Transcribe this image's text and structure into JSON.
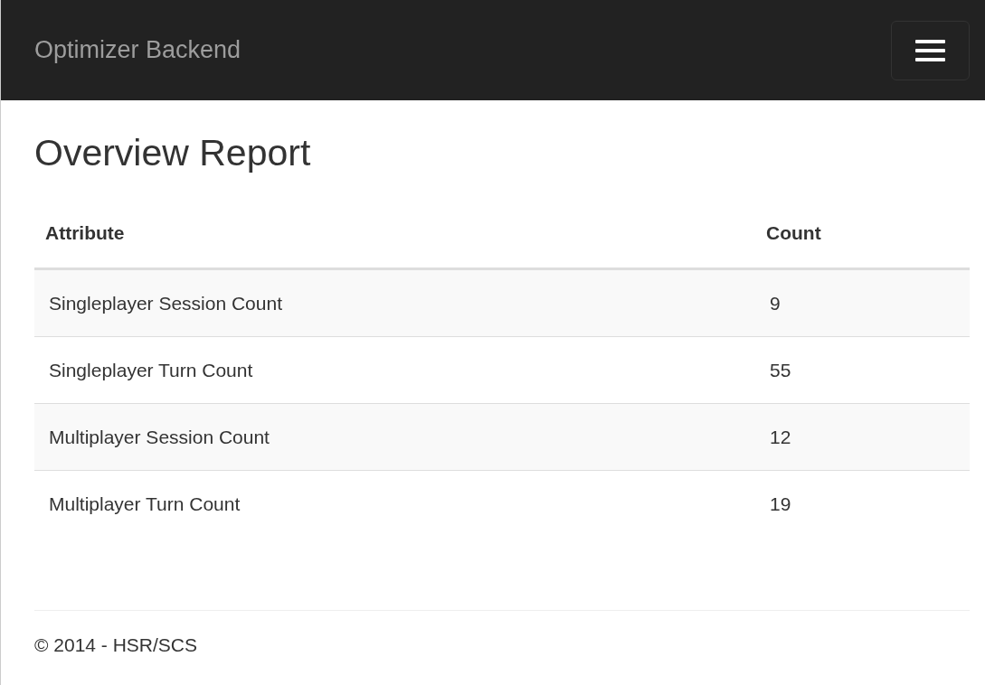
{
  "navbar": {
    "brand": "Optimizer Backend"
  },
  "page": {
    "title": "Overview Report"
  },
  "table": {
    "columns": [
      "Attribute",
      "Count"
    ],
    "rows": [
      [
        "Singleplayer Session Count",
        "9"
      ],
      [
        "Singleplayer Turn Count",
        "55"
      ],
      [
        "Multiplayer Session Count",
        "12"
      ],
      [
        "Multiplayer Turn Count",
        "19"
      ]
    ]
  },
  "footer": {
    "text": "© 2014 - HSR/SCS"
  }
}
